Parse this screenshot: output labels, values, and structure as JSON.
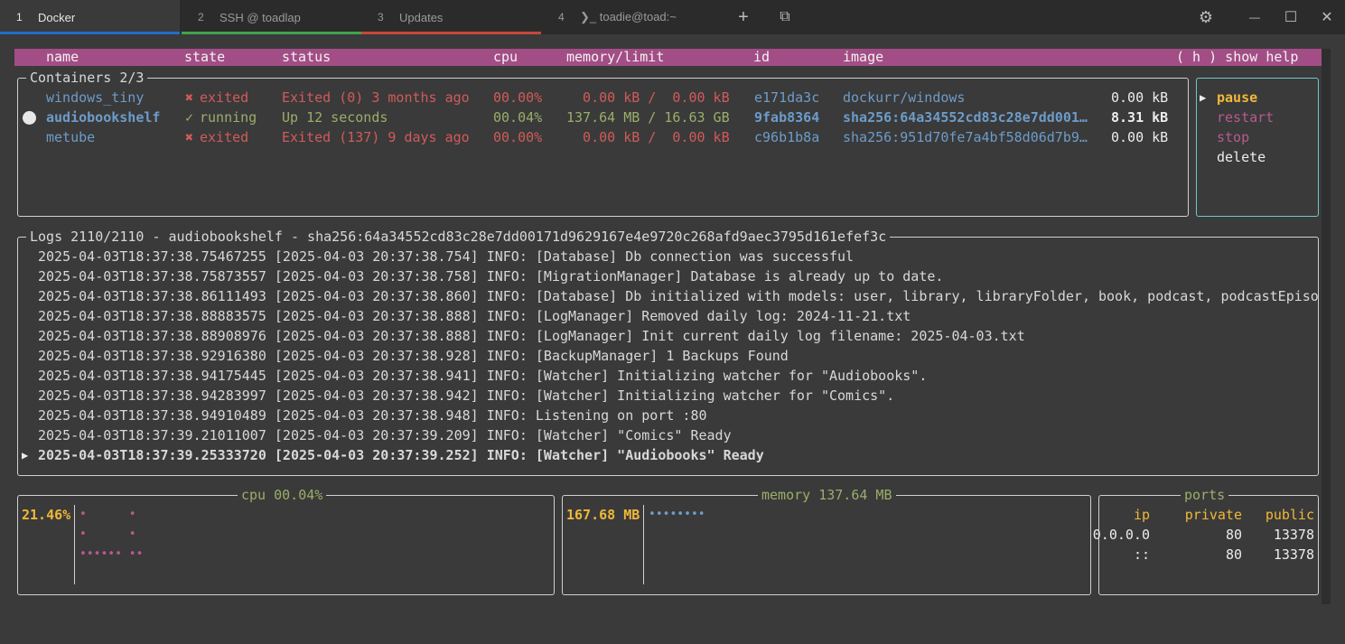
{
  "tabs": [
    {
      "num": "1",
      "label": "Docker",
      "color": "#1f6fc5",
      "active": true
    },
    {
      "num": "2",
      "label": "SSH @ toadlap",
      "color": "#3fa34d",
      "active": false
    },
    {
      "num": "3",
      "label": "Updates",
      "color": "#c9463d",
      "active": false
    },
    {
      "num": "4",
      "label": "❯_ toadie@toad:~",
      "color": "",
      "active": false
    }
  ],
  "window_controls": {
    "new_tab": "+",
    "tab_overview": "⧉",
    "settings": "⚙",
    "minimize": "—",
    "maximize": "☐",
    "close": "✕"
  },
  "header": {
    "name": "name",
    "state": "state",
    "status": "status",
    "cpu": "cpu",
    "memory": "memory/limit",
    "id": "id",
    "image": "image",
    "help": "( h ) show help"
  },
  "containers": {
    "title": "Containers 2/3",
    "rows": [
      {
        "name": "windows_tiny",
        "state_icon": "✖",
        "state": "exited",
        "status": "Exited (0) 3 months ago",
        "cpu": "00.00%",
        "memory": "  0.00 kB /  0.00 kB",
        "id": "e171da3c",
        "image": "dockurr/windows",
        "size": "0.00 kB"
      },
      {
        "name": "audiobookshelf",
        "state_icon": "✓",
        "state": "running",
        "status": "Up 12 seconds",
        "cpu": "00.04%",
        "memory": "137.64 MB / 16.63 GB",
        "id": "9fab8364",
        "image": "sha256:64a34552cd83c28e7dd001…",
        "size": "8.31 kB",
        "selected": true
      },
      {
        "name": "metube",
        "state_icon": "✖",
        "state": "exited",
        "status": "Exited (137) 9 days ago",
        "cpu": "00.00%",
        "memory": "  0.00 kB /  0.00 kB",
        "id": "c96b1b8a",
        "image": "sha256:951d70fe7a4bf58d06d7b9…",
        "size": "0.00 kB"
      }
    ]
  },
  "actions": {
    "pointer": "▶",
    "items": [
      "pause",
      "restart",
      "stop",
      "delete"
    ]
  },
  "logs": {
    "title": "Logs 2110/2110 - audiobookshelf - sha256:64a34552cd83c28e7dd00171d9629167e4e9720c268afd9aec3795d161efef3c",
    "pointer": "▶",
    "lines": [
      "2025-04-03T18:37:38.75467255 [2025-04-03 20:37:38.754] INFO: [Database] Db connection was successful",
      "2025-04-03T18:37:38.75873557 [2025-04-03 20:37:38.758] INFO: [MigrationManager] Database is already up to date.",
      "2025-04-03T18:37:38.86111493 [2025-04-03 20:37:38.860] INFO: [Database] Db initialized with models: user, library, libraryFolder, book, podcast, podcastEpiso",
      "2025-04-03T18:37:38.88883575 [2025-04-03 20:37:38.888] INFO: [LogManager] Removed daily log: 2024-11-21.txt",
      "2025-04-03T18:37:38.88908976 [2025-04-03 20:37:38.888] INFO: [LogManager] Init current daily log filename: 2025-04-03.txt",
      "2025-04-03T18:37:38.92916380 [2025-04-03 20:37:38.928] INFO: [BackupManager] 1 Backups Found",
      "2025-04-03T18:37:38.94175445 [2025-04-03 20:37:38.941] INFO: [Watcher] Initializing watcher for \"Audiobooks\".",
      "2025-04-03T18:37:38.94283997 [2025-04-03 20:37:38.942] INFO: [Watcher] Initializing watcher for \"Comics\".",
      "2025-04-03T18:37:38.94910489 [2025-04-03 20:37:38.948] INFO: Listening on port :80",
      "2025-04-03T18:37:39.21011007 [2025-04-03 20:37:39.209] INFO: [Watcher] \"Comics\" Ready",
      "2025-04-03T18:37:39.25333720 [2025-04-03 20:37:39.252] INFO: [Watcher] \"Audiobooks\" Ready"
    ]
  },
  "cpu_panel": {
    "title": "cpu 00.04%",
    "max": "21.46%"
  },
  "memory_panel": {
    "title": "memory 137.64 MB",
    "max": "167.68 MB"
  },
  "ports_panel": {
    "title": "ports",
    "headers": {
      "ip": "ip",
      "private": "private",
      "public": "public"
    },
    "rows": [
      {
        "ip": "0.0.0.0",
        "private": "80",
        "public": "13378"
      },
      {
        "ip": "::",
        "private": "80",
        "public": "13378"
      }
    ]
  }
}
